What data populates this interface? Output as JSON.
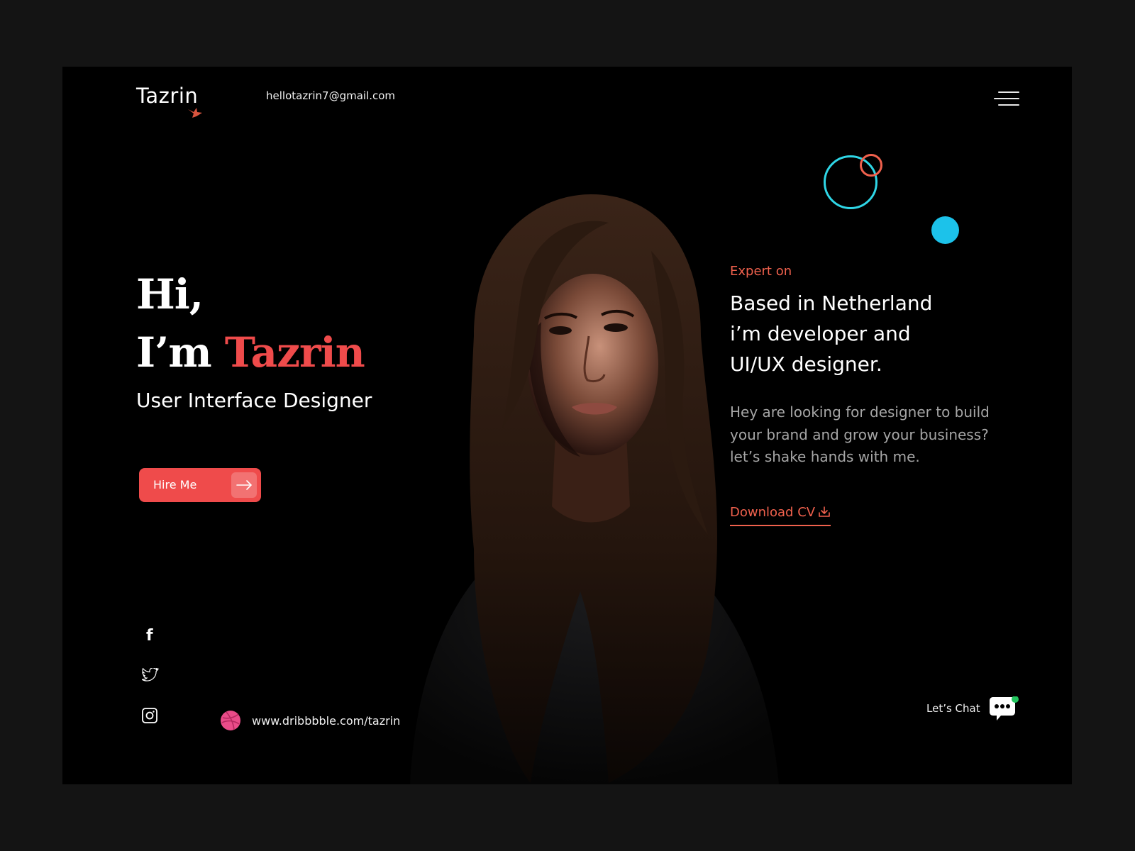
{
  "header": {
    "logo": "Tazrin",
    "email": "hellotazrin7@gmail.com"
  },
  "hero": {
    "greeting_line1": "Hi,",
    "greeting_prefix": "I’m ",
    "name": "Tazrin",
    "role": "User Interface Designer",
    "hire_label": "Hire Me"
  },
  "about": {
    "eyebrow": "Expert on",
    "headline_lines": [
      "Based in Netherland",
      "i’m developer and",
      "UI/UX designer."
    ],
    "description_lines": [
      "Hey are looking for designer to build",
      "your brand and grow your business?",
      "let’s shake hands with me."
    ],
    "download_label": "Download CV"
  },
  "social": {
    "dribbble_url": "www.dribbbble.com/tazrin",
    "items": [
      "facebook-icon",
      "twitter-icon",
      "instagram-icon"
    ]
  },
  "chat": {
    "label": "Let’s Chat",
    "online": true
  },
  "colors": {
    "accent": "#ef4b4b",
    "cyan": "#2fd6e6",
    "blue_dot": "#1cc2ea",
    "online": "#22c55e",
    "dribbble": "#ea4c89"
  }
}
